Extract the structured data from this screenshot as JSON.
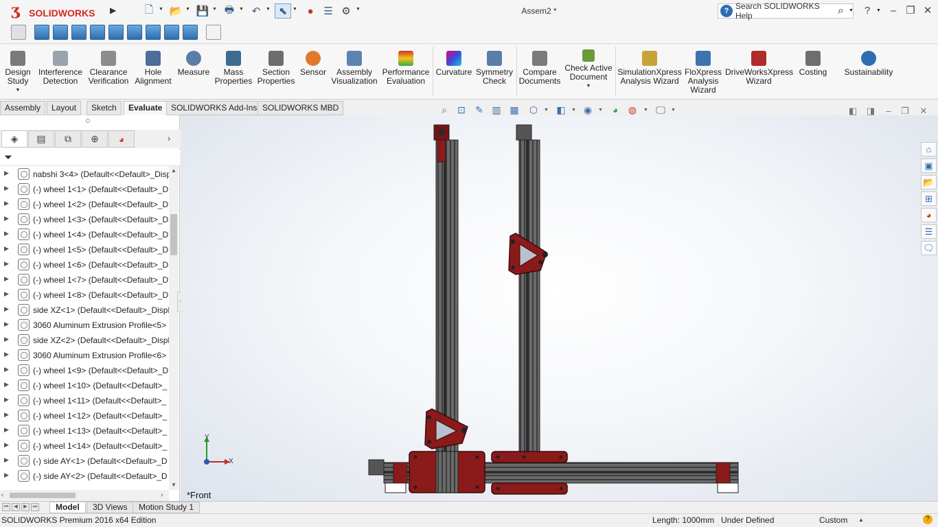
{
  "app": {
    "logo_text": "SOLIDWORKS",
    "document_title": "Assem2 *",
    "help_search_placeholder": "Search SOLIDWORKS Help",
    "help_label": "?"
  },
  "command_manager": {
    "groups": [
      {
        "label": "Design\nStudy"
      },
      {
        "label": "Interference\nDetection"
      },
      {
        "label": "Clearance\nVerification"
      },
      {
        "label": "Hole\nAlignment"
      },
      {
        "label": "Measure"
      },
      {
        "label": "Mass\nProperties"
      },
      {
        "label": "Section\nProperties"
      },
      {
        "label": "Sensor"
      },
      {
        "label": "Assembly\nVisualization"
      },
      {
        "label": "Performance\nEvaluation"
      },
      {
        "label": "Curvature"
      },
      {
        "label": "Symmetry\nCheck"
      },
      {
        "label": "Compare\nDocuments"
      },
      {
        "label": "Check Active\nDocument"
      },
      {
        "label": "SimulationXpress\nAnalysis Wizard"
      },
      {
        "label": "FloXpress\nAnalysis\nWizard"
      },
      {
        "label": "DriveWorksXpress\nWizard"
      },
      {
        "label": "Costing"
      },
      {
        "label": "Sustainability"
      }
    ]
  },
  "tabs": [
    "Assembly",
    "Layout",
    "Sketch",
    "Evaluate",
    "SOLIDWORKS Add-Ins",
    "SOLIDWORKS MBD"
  ],
  "active_tab": "Evaluate",
  "feature_tree": {
    "items": [
      "nabshi 3<4> (Default<<Default>_Disp",
      "(-) wheel 1<1> (Default<<Default>_D",
      "(-) wheel 1<2> (Default<<Default>_D",
      "(-) wheel 1<3> (Default<<Default>_D",
      "(-) wheel 1<4> (Default<<Default>_D",
      "(-) wheel 1<5> (Default<<Default>_D",
      "(-) wheel 1<6> (Default<<Default>_D",
      "(-) wheel 1<7> (Default<<Default>_D",
      "(-) wheel 1<8> (Default<<Default>_D",
      "side XZ<1> (Default<<Default>_Displ",
      "3060 Aluminum Extrusion Profile<5>",
      "side XZ<2> (Default<<Default>_Displ",
      "3060 Aluminum Extrusion Profile<6>",
      "(-) wheel 1<9> (Default<<Default>_D",
      "(-) wheel 1<10> (Default<<Default>_",
      "(-) wheel 1<11> (Default<<Default>_",
      "(-) wheel 1<12> (Default<<Default>_",
      "(-) wheel 1<13> (Default<<Default>_",
      "(-) wheel 1<14> (Default<<Default>_",
      "(-) side AY<1> (Default<<Default>_D",
      "(-) side AY<2> (Default<<Default>_D"
    ]
  },
  "viewport": {
    "view_name": "*Front",
    "triad": {
      "x": "X",
      "y": "Y"
    }
  },
  "bottom_tabs": [
    "Model",
    "3D Views",
    "Motion Study 1"
  ],
  "active_bottom_tab": "Model",
  "status": {
    "edition": "SOLIDWORKS Premium 2016 x64 Edition",
    "length": "Length: 1000mm",
    "state": "Under Defined",
    "units": "Custom"
  },
  "colors": {
    "accent_red": "#8b1a1a",
    "profile_grey": "#5a5a5a",
    "brand_red": "#d42a1e"
  }
}
